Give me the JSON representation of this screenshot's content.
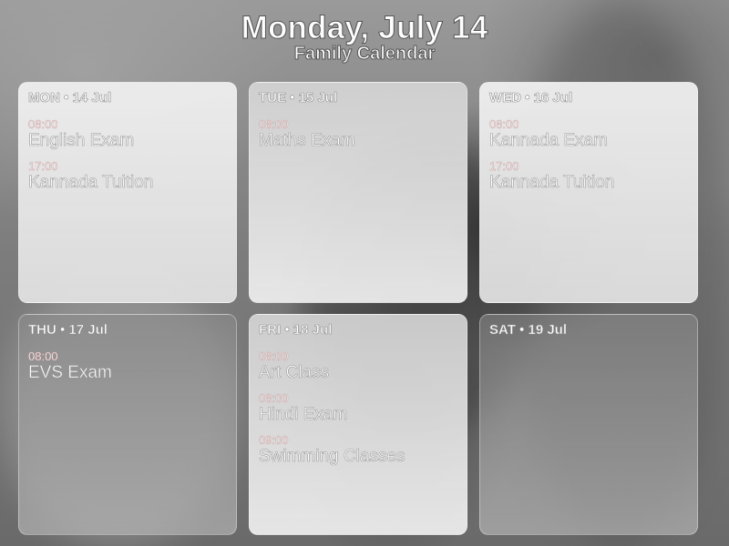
{
  "header": {
    "title": "Monday, July 14",
    "subtitle": "Family Calendar"
  },
  "days": [
    {
      "label": "MON • 14 Jul",
      "events": [
        {
          "time": "08:00",
          "name": "English Exam"
        },
        {
          "time": "17:00",
          "name": "Kannada Tuition"
        }
      ]
    },
    {
      "label": "TUE • 15 Jul",
      "events": [
        {
          "time": "08:00",
          "name": "Maths Exam"
        }
      ]
    },
    {
      "label": "WED • 16 Jul",
      "events": [
        {
          "time": "08:00",
          "name": "Kannada Exam"
        },
        {
          "time": "17:00",
          "name": "Kannada Tuition"
        }
      ]
    },
    {
      "label": "THU • 17 Jul",
      "events": [
        {
          "time": "08:00",
          "name": "EVS Exam"
        }
      ]
    },
    {
      "label": "FRI • 18 Jul",
      "events": [
        {
          "time": "08:00",
          "name": "Art Class"
        },
        {
          "time": "08:00",
          "name": "Hindi Exam"
        },
        {
          "time": "09:00",
          "name": "Swimming Classes"
        }
      ]
    },
    {
      "label": "SAT • 19 Jul",
      "events": []
    }
  ],
  "colors": {
    "text": "#ffffff",
    "text_outline": "#9a9a9a",
    "time_outline": "#c8a0a0",
    "background": "#8f8f8f"
  }
}
